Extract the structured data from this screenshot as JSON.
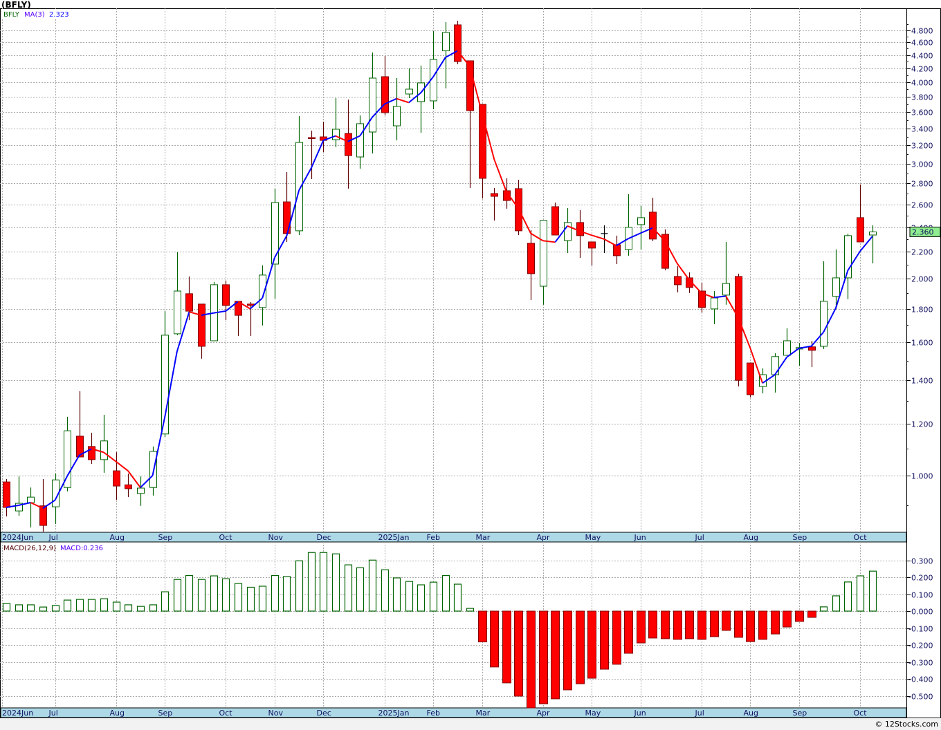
{
  "title": "(BFLY)",
  "footer": "© 12Stocks.com",
  "chart_data": [
    {
      "type": "candlestick",
      "symbol": "BFLY",
      "legend": {
        "symbol_label": "BFLY",
        "ma_label": "MA(3)",
        "ma_value": "2.323"
      },
      "last_price_label": "2.360",
      "y_scale": "log",
      "ylim": [
        0.78,
        5.0
      ],
      "y_ticks": [
        "1.000",
        "1.200",
        "1.400",
        "1.600",
        "1.800",
        "2.000",
        "2.200",
        "2.400",
        "2.600",
        "2.800",
        "3.000",
        "3.200",
        "3.400",
        "3.600",
        "3.800",
        "4.000",
        "4.200",
        "4.400",
        "4.600",
        "4.800"
      ],
      "grid": true,
      "interval": "weekly",
      "month_ticks": [
        {
          "label": "2024Jun",
          "index": 0
        },
        {
          "label": "Jul",
          "index": 4
        },
        {
          "label": "Aug",
          "index": 9
        },
        {
          "label": "Sep",
          "index": 13
        },
        {
          "label": "Oct",
          "index": 18
        },
        {
          "label": "Nov",
          "index": 22
        },
        {
          "label": "Dec",
          "index": 26
        },
        {
          "label": "2025Jan",
          "index": 31
        },
        {
          "label": "Feb",
          "index": 35
        },
        {
          "label": "Mar",
          "index": 39
        },
        {
          "label": "Apr",
          "index": 44
        },
        {
          "label": "May",
          "index": 48
        },
        {
          "label": "Jun",
          "index": 52
        },
        {
          "label": "Jul",
          "index": 57
        },
        {
          "label": "Aug",
          "index": 61
        },
        {
          "label": "Sep",
          "index": 65
        },
        {
          "label": "Oct",
          "index": 70
        }
      ],
      "ohlc": [
        [
          0.978,
          0.988,
          0.866,
          0.894
        ],
        [
          0.883,
          0.997,
          0.868,
          0.907
        ],
        [
          0.909,
          0.959,
          0.833,
          0.927
        ],
        [
          0.899,
          0.988,
          0.821,
          0.839
        ],
        [
          0.896,
          1.007,
          0.843,
          0.985
        ],
        [
          0.959,
          1.23,
          0.946,
          1.171
        ],
        [
          1.149,
          1.346,
          1.066,
          1.068
        ],
        [
          1.108,
          1.163,
          1.042,
          1.058
        ],
        [
          1.058,
          1.239,
          1.01,
          1.13
        ],
        [
          1.017,
          1.086,
          0.918,
          0.964
        ],
        [
          0.968,
          1.007,
          0.927,
          0.955
        ],
        [
          0.939,
          0.997,
          0.899,
          0.957
        ],
        [
          0.959,
          1.108,
          0.932,
          1.089
        ],
        [
          1.158,
          1.785,
          1.146,
          1.64
        ],
        [
          1.648,
          2.197,
          1.64,
          1.916
        ],
        [
          1.898,
          2.017,
          1.729,
          1.785
        ],
        [
          1.83,
          1.83,
          1.51,
          1.577
        ],
        [
          1.608,
          1.978,
          1.608,
          1.959
        ],
        [
          1.959,
          1.987,
          1.729,
          1.821
        ],
        [
          1.848,
          1.848,
          1.636,
          1.759
        ],
        [
          1.83,
          1.843,
          1.636,
          1.821
        ],
        [
          1.808,
          2.097,
          1.697,
          2.027
        ],
        [
          2.107,
          2.748,
          1.866,
          2.617
        ],
        [
          2.623,
          2.913,
          2.278,
          2.346
        ],
        [
          2.369,
          3.548,
          2.334,
          3.234
        ],
        [
          3.29,
          3.371,
          2.843,
          3.282
        ],
        [
          3.298,
          3.48,
          3.126,
          3.258
        ],
        [
          3.266,
          3.781,
          3.18,
          3.388
        ],
        [
          3.338,
          3.762,
          2.748,
          3.088
        ],
        [
          3.073,
          3.557,
          2.949,
          3.455
        ],
        [
          3.355,
          4.44,
          3.111,
          4.057
        ],
        [
          4.077,
          4.386,
          3.557,
          3.592
        ],
        [
          3.429,
          4.057,
          3.258,
          3.672
        ],
        [
          3.836,
          4.198,
          3.781,
          3.902
        ],
        [
          3.735,
          4.24,
          3.346,
          3.989
        ],
        [
          3.744,
          4.788,
          3.636,
          4.333
        ],
        [
          4.466,
          4.941,
          3.912,
          4.765
        ],
        [
          4.894,
          4.966,
          4.26,
          4.301
        ],
        [
          4.312,
          4.312,
          2.755,
          3.618
        ],
        [
          3.699,
          3.699,
          2.655,
          2.85
        ],
        [
          2.701,
          2.755,
          2.457,
          2.675
        ],
        [
          2.728,
          2.85,
          2.561,
          2.636
        ],
        [
          2.748,
          2.836,
          2.334,
          2.369
        ],
        [
          2.267,
          2.375,
          1.857,
          2.037
        ],
        [
          1.949,
          2.457,
          1.826,
          2.457
        ],
        [
          2.579,
          2.617,
          2.334,
          2.334
        ],
        [
          2.289,
          2.567,
          2.191,
          2.439
        ],
        [
          2.439,
          2.548,
          2.154,
          2.329
        ],
        [
          2.278,
          2.278,
          2.097,
          2.229
        ],
        [
          2.346,
          2.415,
          2.191,
          2.346
        ],
        [
          2.256,
          2.329,
          2.107,
          2.17
        ],
        [
          2.218,
          2.695,
          2.17,
          2.398
        ],
        [
          2.421,
          2.586,
          2.218,
          2.481
        ],
        [
          2.53,
          2.662,
          2.284,
          2.301
        ],
        [
          2.34,
          2.381,
          2.061,
          2.076
        ],
        [
          2.017,
          2.091,
          1.907,
          1.959
        ],
        [
          2.007,
          2.046,
          1.903,
          1.94
        ],
        [
          1.916,
          1.973,
          1.776,
          1.808
        ],
        [
          1.799,
          1.916,
          1.705,
          1.87
        ],
        [
          1.889,
          2.278,
          1.826,
          1.968
        ],
        [
          2.017,
          2.037,
          1.369,
          1.399
        ],
        [
          1.487,
          1.487,
          1.317,
          1.33
        ],
        [
          1.369,
          1.459,
          1.336,
          1.427
        ],
        [
          1.427,
          1.539,
          1.34,
          1.521
        ],
        [
          1.528,
          1.68,
          1.528,
          1.608
        ],
        [
          1.562,
          1.596,
          1.473,
          1.57
        ],
        [
          1.574,
          1.608,
          1.466,
          1.555
        ],
        [
          1.577,
          2.128,
          1.562,
          1.848
        ],
        [
          1.88,
          2.218,
          1.799,
          2.007
        ],
        [
          2.007,
          2.346,
          1.862,
          2.329
        ],
        [
          2.481,
          2.789,
          2.278,
          2.278
        ],
        [
          2.334,
          2.415,
          2.112,
          2.36
        ]
      ],
      "ma_period": 3,
      "colors": {
        "up_border": "#006400",
        "down_fill": "#ff0000",
        "down_border": "#800000",
        "ma_up": "#0000ff",
        "ma_down": "#ff0000",
        "axis_band": "#add8e6"
      }
    },
    {
      "type": "bar",
      "legend": {
        "label": "MACD(26,12,9)",
        "value_label": "MACD:0.236"
      },
      "ylim": [
        -0.58,
        0.36
      ],
      "y_ticks": [
        "0.300",
        "0.200",
        "0.100",
        "0.000",
        "-0.100",
        "-0.200",
        "-0.300",
        "-0.400",
        "-0.500"
      ],
      "values": [
        0.045,
        0.037,
        0.037,
        0.024,
        0.033,
        0.065,
        0.069,
        0.069,
        0.073,
        0.053,
        0.037,
        0.028,
        0.037,
        0.114,
        0.187,
        0.21,
        0.187,
        0.208,
        0.191,
        0.163,
        0.141,
        0.147,
        0.21,
        0.204,
        0.297,
        0.346,
        0.346,
        0.338,
        0.273,
        0.256,
        0.301,
        0.244,
        0.196,
        0.175,
        0.155,
        0.171,
        0.21,
        0.159,
        0.016,
        -0.182,
        -0.33,
        -0.424,
        -0.502,
        -0.58,
        -0.547,
        -0.518,
        -0.465,
        -0.429,
        -0.396,
        -0.343,
        -0.314,
        -0.249,
        -0.188,
        -0.159,
        -0.163,
        -0.167,
        -0.163,
        -0.167,
        -0.151,
        -0.114,
        -0.155,
        -0.18,
        -0.167,
        -0.135,
        -0.094,
        -0.061,
        -0.037,
        0.025,
        0.09,
        0.172,
        0.208,
        0.236
      ],
      "colors": {
        "positive": "#006400",
        "negative": "#ff0000"
      }
    }
  ]
}
